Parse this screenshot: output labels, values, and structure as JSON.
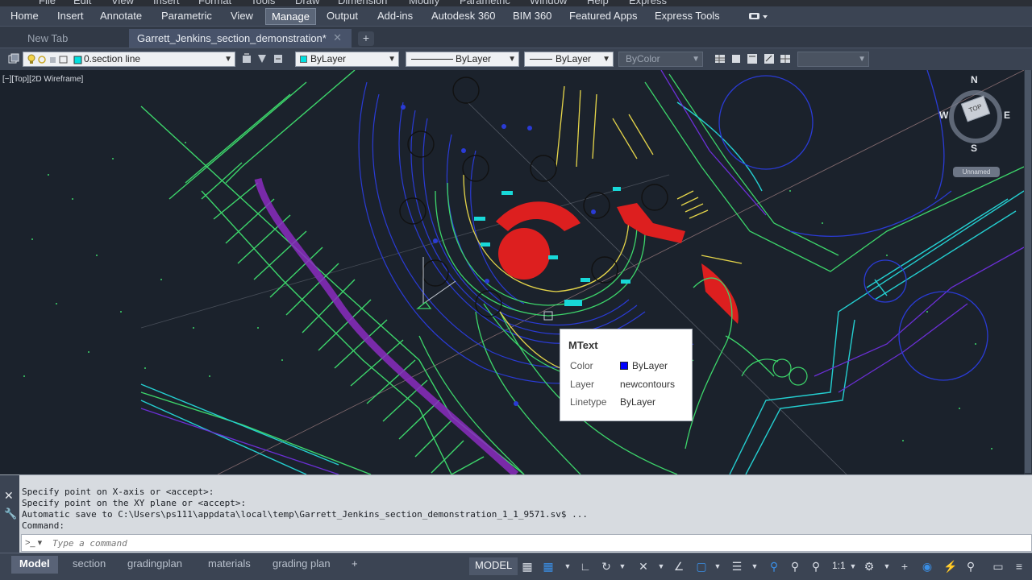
{
  "menubar": {
    "items": [
      "File",
      "Edit",
      "View",
      "Insert",
      "Format",
      "Tools",
      "Draw",
      "Dimension",
      "Modify",
      "Parametric",
      "Window",
      "Help",
      "Express"
    ]
  },
  "ribbon": {
    "tabs": [
      "Home",
      "Insert",
      "Annotate",
      "Parametric",
      "View",
      "Manage",
      "Output",
      "Add-ins",
      "Autodesk 360",
      "BIM 360",
      "Featured Apps",
      "Express Tools"
    ],
    "active_tab": "Manage"
  },
  "file_tabs": {
    "new_tab": "New Tab",
    "document": "Garrett_Jenkins_section_demonstration*",
    "close_glyph": "✕",
    "add_glyph": "+"
  },
  "properties_toolbar": {
    "layer": "0.section line",
    "color": "ByLayer",
    "linetype": "ByLayer",
    "lineweight": "ByLayer",
    "plot_style": "ByColor",
    "color_swatch": "#00e0e0"
  },
  "viewport": {
    "label": "[−][Top][2D Wireframe]",
    "viewcube": {
      "north": "N",
      "south": "S",
      "east": "E",
      "west": "W",
      "face": "TOP",
      "ucs_label": "Unnamed"
    }
  },
  "tooltip": {
    "title": "MText",
    "rows": [
      {
        "label": "Color",
        "value": "ByLayer"
      },
      {
        "label": "Layer",
        "value": "newcontours"
      },
      {
        "label": "Linetype",
        "value": "ByLayer"
      }
    ],
    "swatch_color": "#0000ff"
  },
  "command": {
    "history": [
      "Specify point on X-axis or <accept>:",
      "Specify point on the XY plane or <accept>:",
      "Automatic save to C:\\Users\\ps111\\appdata\\local\\temp\\Garrett_Jenkins_section_demonstration_1_1_9571.sv$ ...",
      "Command:"
    ],
    "placeholder": "Type a command"
  },
  "layout_tabs": {
    "tabs": [
      "Model",
      "section",
      "gradingplan",
      "materials",
      "grading plan"
    ],
    "active": "Model",
    "add_glyph": "+"
  },
  "status_bar": {
    "model": "MODEL",
    "scale": "1:1"
  },
  "colors": {
    "ribbon_bg": "#3b4453",
    "canvas_bg": "#1b222c",
    "active_tab": "#5b6678"
  }
}
